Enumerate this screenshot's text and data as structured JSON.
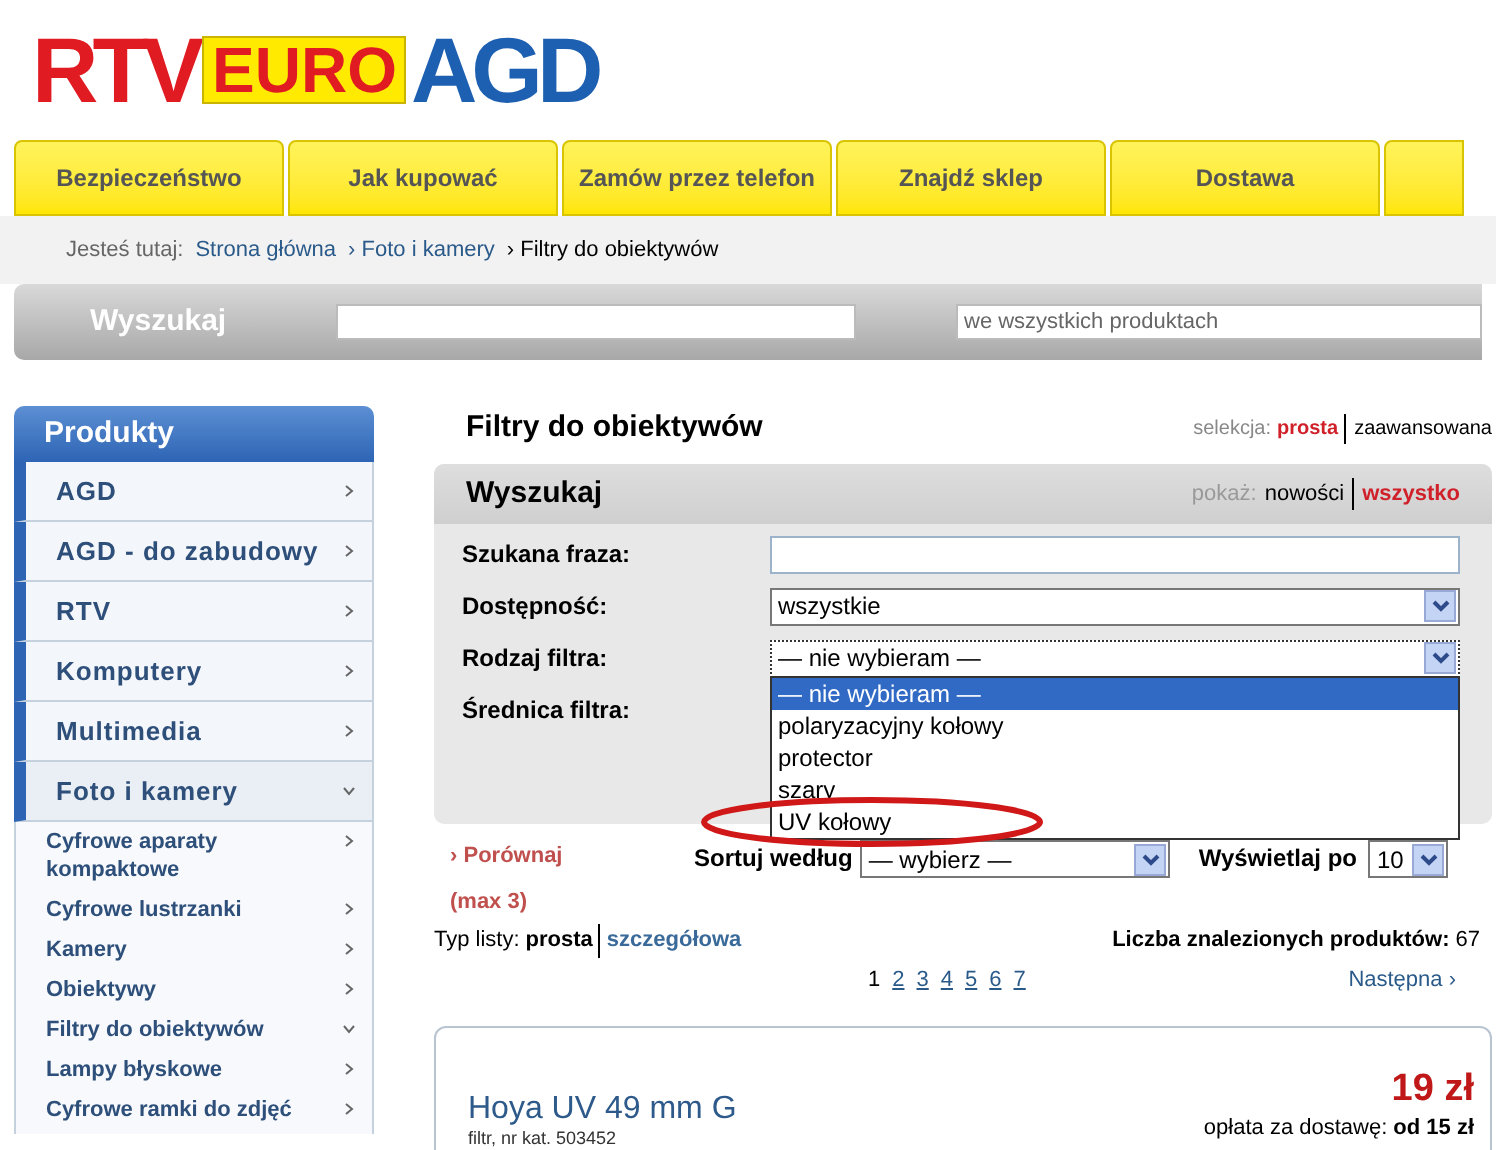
{
  "logo": {
    "part_1": "RTV",
    "part_2": "EURO",
    "part_3": "AGD"
  },
  "nav_tabs": [
    {
      "label": "Bezpieczeństwo"
    },
    {
      "label": "Jak kupować"
    },
    {
      "label": "Zamów przez telefon"
    },
    {
      "label": "Znajdź sklep"
    },
    {
      "label": "Dostawa"
    }
  ],
  "breadcrumb": {
    "label": "Jesteś tutaj:",
    "links": [
      "Strona główna",
      "Foto i kamery"
    ],
    "current": "Filtry do obiektywów",
    "separator": "›"
  },
  "search_bar": {
    "label": "Wyszukaj",
    "scope_placeholder": "we wszystkich produktach"
  },
  "sidebar": {
    "title": "Produkty",
    "items": [
      {
        "label": "AGD",
        "expanded": false
      },
      {
        "label": "AGD - do zabudowy",
        "expanded": false
      },
      {
        "label": "RTV",
        "expanded": false
      },
      {
        "label": "Komputery",
        "expanded": false
      },
      {
        "label": "Multimedia",
        "expanded": false
      },
      {
        "label": "Foto i kamery",
        "expanded": true,
        "children": [
          {
            "label": "Cyfrowe aparaty kompaktowe",
            "expanded": false
          },
          {
            "label": "Cyfrowe lustrzanki",
            "expanded": false
          },
          {
            "label": "Kamery",
            "expanded": false
          },
          {
            "label": "Obiektywy",
            "expanded": false
          },
          {
            "label": "Filtry do obiektywów",
            "expanded": true
          },
          {
            "label": "Lampy błyskowe",
            "expanded": false
          },
          {
            "label": "Cyfrowe ramki do zdjęć",
            "expanded": false
          }
        ]
      }
    ]
  },
  "page_title": "Filtry do obiektywów",
  "selection_mode": {
    "label": "selekcja:",
    "options": [
      {
        "label": "prosta",
        "selected": true
      },
      {
        "label": "zaawansowana",
        "selected": false
      }
    ]
  },
  "search_panel": {
    "title": "Wyszukaj",
    "show": {
      "label": "pokaż:",
      "options": [
        {
          "label": "nowości",
          "selected": false
        },
        {
          "label": "wszystko",
          "selected": true
        }
      ]
    },
    "fields": [
      {
        "label": "Szukana fraza:",
        "kind": "text"
      },
      {
        "label": "Dostępność:",
        "kind": "select",
        "value": "wszystkie"
      },
      {
        "label": "Rodzaj filtra:",
        "kind": "select",
        "value": "— nie wybieram —",
        "expanded": true,
        "options": [
          {
            "label": "— nie wybieram —",
            "selected": true
          },
          {
            "label": "polaryzacyjny kołowy",
            "selected": false
          },
          {
            "label": "protector",
            "selected": false
          },
          {
            "label": "szary",
            "selected": false
          },
          {
            "label": "UV kołowy",
            "selected": false,
            "circled": true
          }
        ]
      },
      {
        "label": "Średnica filtra:",
        "kind": "none"
      }
    ]
  },
  "compare": {
    "marker": "›",
    "label": "Porównaj",
    "note": "(max 3)"
  },
  "sort": {
    "label": "Sortuj według",
    "value": "— wybierz —"
  },
  "per_page": {
    "label": "Wyświetlaj po",
    "value": "10"
  },
  "list_type": {
    "label": "Typ listy:",
    "options": [
      {
        "label": "prosta",
        "selected": true
      },
      {
        "label": "szczegółowa",
        "selected": false
      }
    ]
  },
  "results_count": {
    "label": "Liczba znalezionych produktów:",
    "value": "67"
  },
  "pagination": {
    "pages": [
      {
        "label": "1",
        "selected": true
      },
      {
        "label": "2",
        "selected": false
      },
      {
        "label": "3",
        "selected": false
      },
      {
        "label": "4",
        "selected": false
      },
      {
        "label": "5",
        "selected": false
      },
      {
        "label": "6",
        "selected": false
      },
      {
        "label": "7",
        "selected": false
      }
    ],
    "next": "Następna ›"
  },
  "product": {
    "name": "Hoya UV 49 mm G",
    "meta": "filtr, nr kat. 503452",
    "price": "19 zł",
    "delivery_label": "opłata za dostawę:",
    "delivery_value": "od 15 zł"
  }
}
